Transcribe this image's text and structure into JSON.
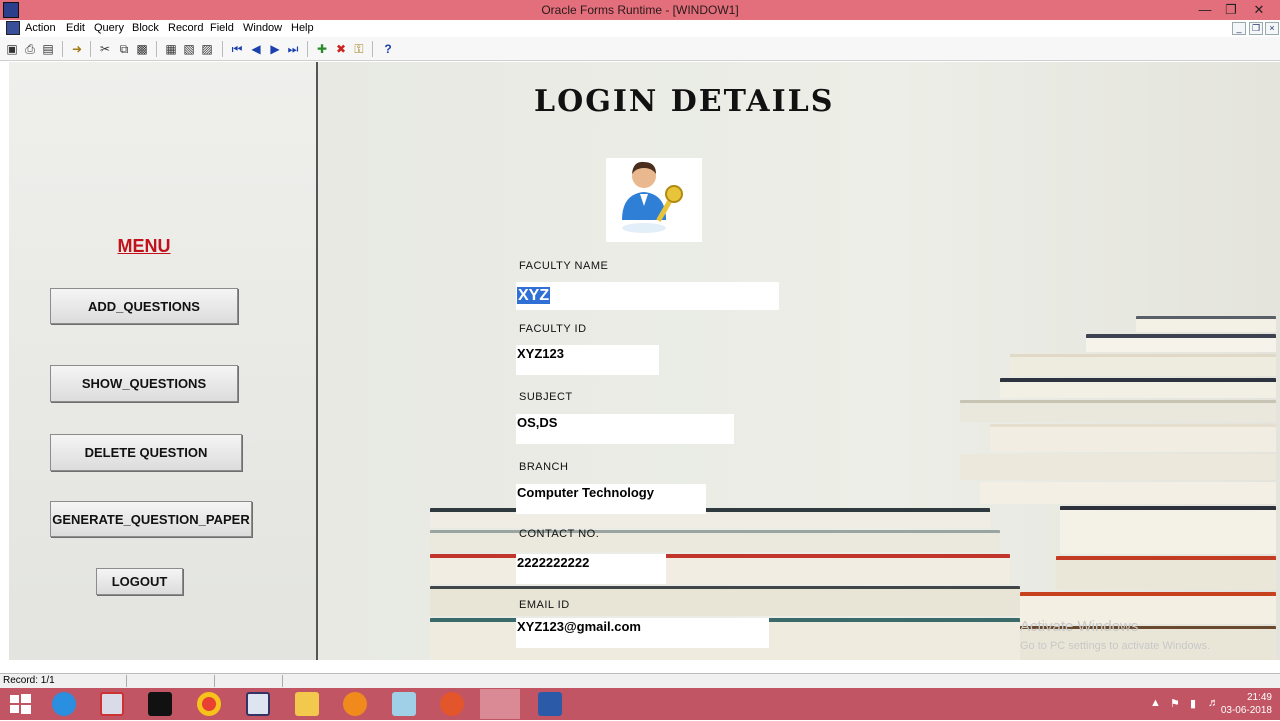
{
  "window": {
    "title": "Oracle Forms Runtime - [WINDOW1]",
    "controls": [
      "minimize-icon",
      "restore-icon",
      "close-icon"
    ]
  },
  "menubar": {
    "items": [
      "Action",
      "Edit",
      "Query",
      "Block",
      "Record",
      "Field",
      "Window",
      "Help"
    ]
  },
  "toolbar": {
    "icons": [
      "save-icon",
      "print-icon",
      "print-setup-icon",
      "exit-icon",
      "cut-icon",
      "copy-icon",
      "paste-icon",
      "enter-query-icon",
      "execute-query-icon",
      "cancel-query-icon",
      "first-record-icon",
      "previous-record-icon",
      "next-record-icon",
      "last-record-icon",
      "insert-record-icon",
      "remove-record-icon",
      "lock-record-icon",
      "help-icon"
    ],
    "help_glyph": "?"
  },
  "left_menu": {
    "title": "MENU",
    "buttons": [
      "ADD_QUESTIONS",
      "SHOW_QUESTIONS",
      "DELETE QUESTION",
      "GENERATE_QUESTION_PAPER",
      "LOGOUT"
    ]
  },
  "form": {
    "heading": "LOGIN DETAILS",
    "fields": [
      {
        "label": "FACULTY NAME",
        "value": "XYZ"
      },
      {
        "label": "FACULTY ID",
        "value": "XYZ123"
      },
      {
        "label": "SUBJECT",
        "value": "OS,DS"
      },
      {
        "label": "BRANCH",
        "value": "Computer Technology"
      },
      {
        "label": "CONTACT NO.",
        "value": "2222222222"
      },
      {
        "label": "EMAIL ID",
        "value": "XYZ123@gmail.com"
      }
    ]
  },
  "watermark": {
    "line1": "Activate Windows",
    "line2": "Go to PC settings to activate Windows."
  },
  "statusbar": {
    "record": "Record: 1/1"
  },
  "taskbar": {
    "apps": [
      "windows-start-icon",
      "internet-explorer-icon",
      "oracle-forms-builder-icon",
      "apple-icon",
      "chrome-icon",
      "app-icon",
      "file-explorer-icon",
      "firefox-icon",
      "app-icon-2",
      "app-icon-3",
      "oracle-forms-runtime-icon",
      "word-icon"
    ],
    "time": "21:49",
    "date": "03-06-2018"
  },
  "colors": {
    "titlebar": "#e36f7c",
    "taskbar": "#c25564",
    "menu_title": "#c1121c",
    "selection": "#2f6fd6"
  }
}
